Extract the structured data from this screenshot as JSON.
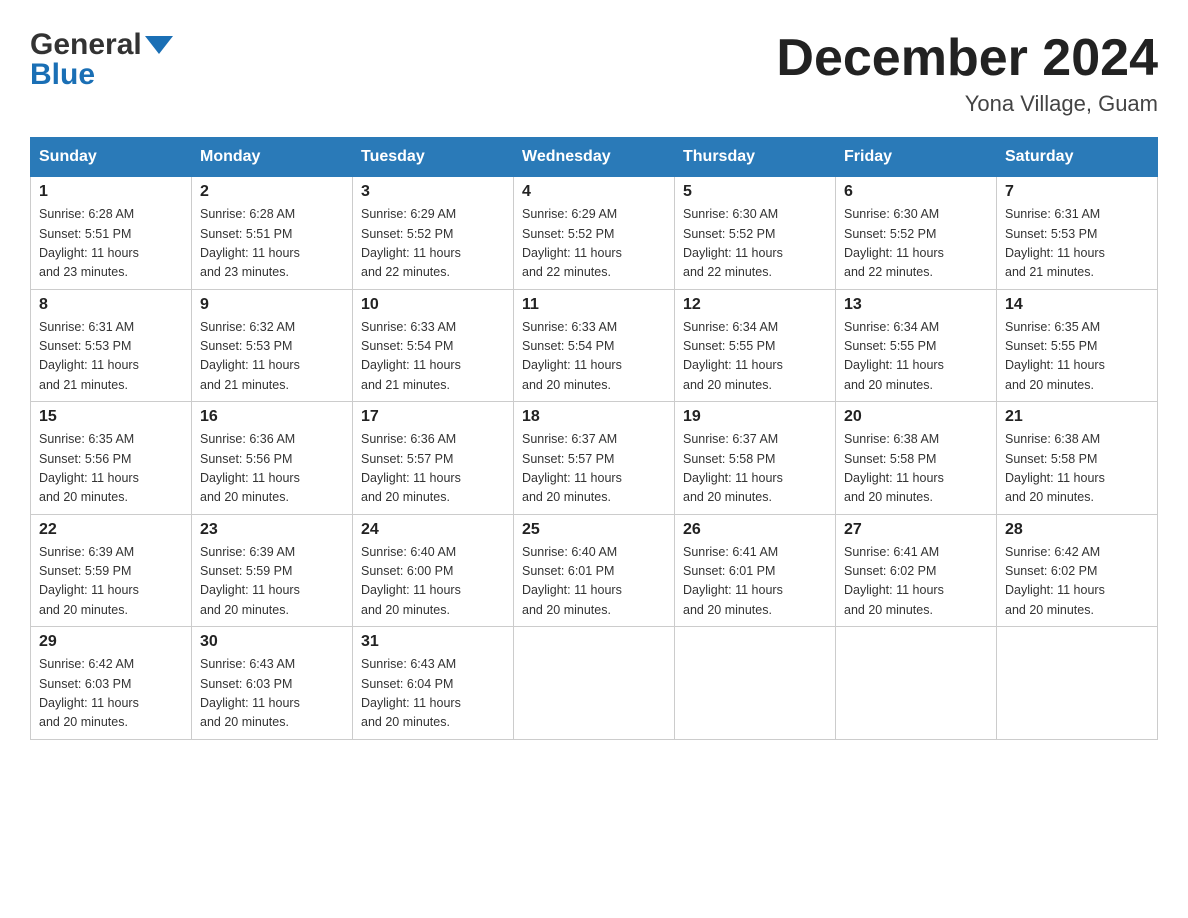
{
  "header": {
    "logo_general": "General",
    "logo_blue": "Blue",
    "month_title": "December 2024",
    "location": "Yona Village, Guam"
  },
  "days_of_week": [
    "Sunday",
    "Monday",
    "Tuesday",
    "Wednesday",
    "Thursday",
    "Friday",
    "Saturday"
  ],
  "weeks": [
    [
      {
        "day": "1",
        "sunrise": "6:28 AM",
        "sunset": "5:51 PM",
        "daylight": "11 hours and 23 minutes."
      },
      {
        "day": "2",
        "sunrise": "6:28 AM",
        "sunset": "5:51 PM",
        "daylight": "11 hours and 23 minutes."
      },
      {
        "day": "3",
        "sunrise": "6:29 AM",
        "sunset": "5:52 PM",
        "daylight": "11 hours and 22 minutes."
      },
      {
        "day": "4",
        "sunrise": "6:29 AM",
        "sunset": "5:52 PM",
        "daylight": "11 hours and 22 minutes."
      },
      {
        "day": "5",
        "sunrise": "6:30 AM",
        "sunset": "5:52 PM",
        "daylight": "11 hours and 22 minutes."
      },
      {
        "day": "6",
        "sunrise": "6:30 AM",
        "sunset": "5:52 PM",
        "daylight": "11 hours and 22 minutes."
      },
      {
        "day": "7",
        "sunrise": "6:31 AM",
        "sunset": "5:53 PM",
        "daylight": "11 hours and 21 minutes."
      }
    ],
    [
      {
        "day": "8",
        "sunrise": "6:31 AM",
        "sunset": "5:53 PM",
        "daylight": "11 hours and 21 minutes."
      },
      {
        "day": "9",
        "sunrise": "6:32 AM",
        "sunset": "5:53 PM",
        "daylight": "11 hours and 21 minutes."
      },
      {
        "day": "10",
        "sunrise": "6:33 AM",
        "sunset": "5:54 PM",
        "daylight": "11 hours and 21 minutes."
      },
      {
        "day": "11",
        "sunrise": "6:33 AM",
        "sunset": "5:54 PM",
        "daylight": "11 hours and 20 minutes."
      },
      {
        "day": "12",
        "sunrise": "6:34 AM",
        "sunset": "5:55 PM",
        "daylight": "11 hours and 20 minutes."
      },
      {
        "day": "13",
        "sunrise": "6:34 AM",
        "sunset": "5:55 PM",
        "daylight": "11 hours and 20 minutes."
      },
      {
        "day": "14",
        "sunrise": "6:35 AM",
        "sunset": "5:55 PM",
        "daylight": "11 hours and 20 minutes."
      }
    ],
    [
      {
        "day": "15",
        "sunrise": "6:35 AM",
        "sunset": "5:56 PM",
        "daylight": "11 hours and 20 minutes."
      },
      {
        "day": "16",
        "sunrise": "6:36 AM",
        "sunset": "5:56 PM",
        "daylight": "11 hours and 20 minutes."
      },
      {
        "day": "17",
        "sunrise": "6:36 AM",
        "sunset": "5:57 PM",
        "daylight": "11 hours and 20 minutes."
      },
      {
        "day": "18",
        "sunrise": "6:37 AM",
        "sunset": "5:57 PM",
        "daylight": "11 hours and 20 minutes."
      },
      {
        "day": "19",
        "sunrise": "6:37 AM",
        "sunset": "5:58 PM",
        "daylight": "11 hours and 20 minutes."
      },
      {
        "day": "20",
        "sunrise": "6:38 AM",
        "sunset": "5:58 PM",
        "daylight": "11 hours and 20 minutes."
      },
      {
        "day": "21",
        "sunrise": "6:38 AM",
        "sunset": "5:58 PM",
        "daylight": "11 hours and 20 minutes."
      }
    ],
    [
      {
        "day": "22",
        "sunrise": "6:39 AM",
        "sunset": "5:59 PM",
        "daylight": "11 hours and 20 minutes."
      },
      {
        "day": "23",
        "sunrise": "6:39 AM",
        "sunset": "5:59 PM",
        "daylight": "11 hours and 20 minutes."
      },
      {
        "day": "24",
        "sunrise": "6:40 AM",
        "sunset": "6:00 PM",
        "daylight": "11 hours and 20 minutes."
      },
      {
        "day": "25",
        "sunrise": "6:40 AM",
        "sunset": "6:01 PM",
        "daylight": "11 hours and 20 minutes."
      },
      {
        "day": "26",
        "sunrise": "6:41 AM",
        "sunset": "6:01 PM",
        "daylight": "11 hours and 20 minutes."
      },
      {
        "day": "27",
        "sunrise": "6:41 AM",
        "sunset": "6:02 PM",
        "daylight": "11 hours and 20 minutes."
      },
      {
        "day": "28",
        "sunrise": "6:42 AM",
        "sunset": "6:02 PM",
        "daylight": "11 hours and 20 minutes."
      }
    ],
    [
      {
        "day": "29",
        "sunrise": "6:42 AM",
        "sunset": "6:03 PM",
        "daylight": "11 hours and 20 minutes."
      },
      {
        "day": "30",
        "sunrise": "6:43 AM",
        "sunset": "6:03 PM",
        "daylight": "11 hours and 20 minutes."
      },
      {
        "day": "31",
        "sunrise": "6:43 AM",
        "sunset": "6:04 PM",
        "daylight": "11 hours and 20 minutes."
      },
      null,
      null,
      null,
      null
    ]
  ],
  "labels": {
    "sunrise": "Sunrise:",
    "sunset": "Sunset:",
    "daylight": "Daylight:"
  }
}
